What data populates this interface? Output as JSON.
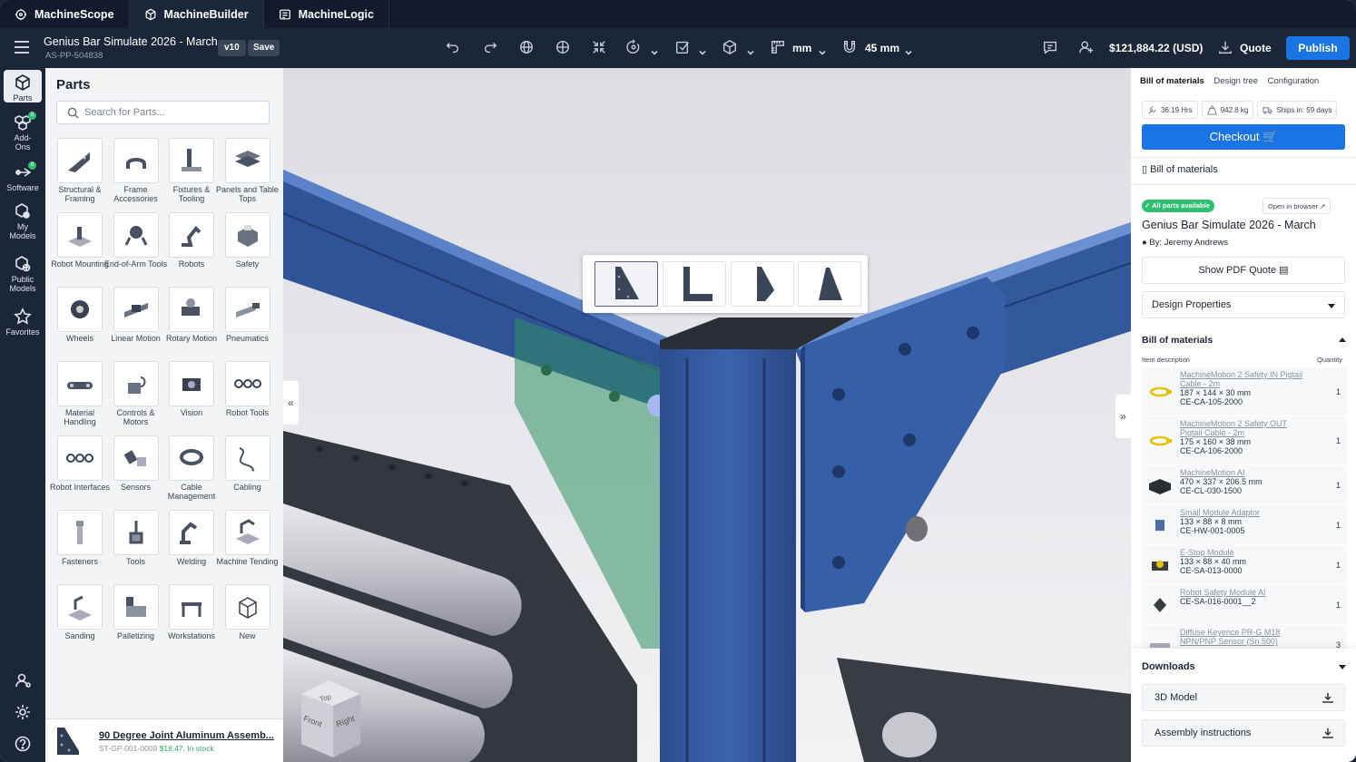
{
  "tabs": [
    {
      "label": "MachineScope",
      "icon": "scope-icon"
    },
    {
      "label": "MachineBuilder",
      "icon": "cube-icon"
    },
    {
      "label": "MachineLogic",
      "icon": "logic-icon"
    }
  ],
  "header": {
    "project_title": "Genius Bar Simulate 2026 - March",
    "project_id": "AS-PP-504838",
    "version": "v10",
    "save_label": "Save",
    "units": "mm",
    "snap": "45 mm",
    "price": "$121,884.22 (USD)",
    "quote_label": "Quote",
    "publish_label": "Publish"
  },
  "rail": [
    {
      "label": "Parts",
      "icon": "parts-icon"
    },
    {
      "label": "Add-Ons",
      "icon": "addons-icon",
      "badge": "5"
    },
    {
      "label": "Software",
      "icon": "software-icon",
      "badge": "0"
    },
    {
      "label": "My Models",
      "icon": "my-models-icon"
    },
    {
      "label": "Public Models",
      "icon": "public-models-icon"
    },
    {
      "label": "Favorites",
      "icon": "star-icon"
    }
  ],
  "parts_panel": {
    "title": "Parts",
    "search_placeholder": "Search for Parts...",
    "categories": [
      "Structural & Framing",
      "Frame Accessories",
      "Fixtures & Tooling",
      "Panels and Table Tops",
      "Robot Mounting",
      "End-of-Arm Tools",
      "Robots",
      "Safety",
      "Wheels",
      "Linear Motion",
      "Rotary Motion",
      "Pneumatics",
      "Material Handling",
      "Controls & Motors",
      "Vision",
      "Robot Tools",
      "Robot Interfaces",
      "Sensors",
      "Cable Management",
      "Cabling",
      "Fasteners",
      "Tools",
      "Welding",
      "Machine Tending",
      "Sanding",
      "Palletizing",
      "Workstations",
      "New"
    ],
    "selected_part": {
      "name": "90 Degree Joint Aluminum Assemb...",
      "sku": "ST-GP-001-0009",
      "price": "$18.47, In stock"
    }
  },
  "viewport": {
    "cube_faces": [
      "Top",
      "Front",
      "Right"
    ],
    "collapse_left": "«",
    "collapse_right": "»"
  },
  "right_panel": {
    "tabs": [
      "Bill of materials",
      "Design tree",
      "Configuration"
    ],
    "stats": {
      "hours": "36:19 Hrs",
      "weight": "942.8 kg",
      "ships": "Ships in: 59 days"
    },
    "checkout_label": "Checkout",
    "bom_header": "Bill of materials",
    "availability": "All parts available",
    "open_browser": "Open in browser",
    "project_name": "Genius Bar Simulate 2026 - March",
    "author": "By: Jeremy Andrews",
    "pdf_quote": "Show PDF Quote",
    "design_properties": "Design Properties",
    "bom_title": "Bill of materials",
    "col_item": "Item description",
    "col_qty": "Quantity",
    "items": [
      {
        "name": "MachineMotion 2 Safety IN Pigtail Cable - 2m",
        "dims": "187 × 144 × 30 mm",
        "sku": "CE-CA-105-2000",
        "qty": "1",
        "icon": "yellow-cable-icon"
      },
      {
        "name": "MachineMotion 2 Safety OUT Pigtail Cable - 2m",
        "dims": "175 × 160 × 38 mm",
        "sku": "CE-CA-106-2000",
        "qty": "1",
        "icon": "yellow-cable-icon"
      },
      {
        "name": "MachineMotion AI",
        "dims": "470 × 337 × 206.5 mm",
        "sku": "CE-CL-030-1500",
        "qty": "1",
        "icon": "controller-icon"
      },
      {
        "name": "Small Module Adaptor",
        "dims": "133 × 88 × 8 mm",
        "sku": "CE-HW-001-0005",
        "qty": "1",
        "icon": "adaptor-icon"
      },
      {
        "name": "E-Stop Module",
        "dims": "133 × 88 × 40 mm",
        "sku": "CE-SA-013-0000",
        "qty": "1",
        "icon": "estop-icon"
      },
      {
        "name": "Robot Safety Module AI",
        "dims": "",
        "sku": "CE-SA-016-0001__2",
        "qty": "1",
        "icon": "safety-module-icon"
      },
      {
        "name": "Diffuse Keyence PR-G M18 NPN/PNP Sensor (Sn 500)",
        "dims": "",
        "sku": "",
        "qty": "3",
        "icon": "sensor-icon"
      }
    ],
    "downloads_title": "Downloads",
    "downloads": [
      "3D Model",
      "Assembly instructions"
    ]
  }
}
